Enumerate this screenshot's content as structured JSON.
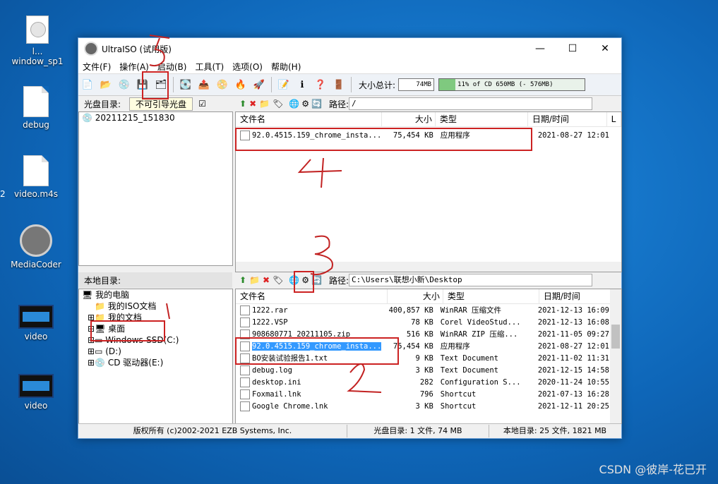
{
  "desktop": {
    "icons": [
      {
        "label": "l... window_sp1",
        "kind": "cd"
      },
      {
        "label": "debug",
        "kind": "doc"
      },
      {
        "label": "video.m4s",
        "kind": "doc"
      },
      {
        "label": "MediaCoder",
        "kind": "reel"
      },
      {
        "label": "video",
        "kind": "vid"
      },
      {
        "label": "video",
        "kind": "vid"
      }
    ],
    "edge_label": "2",
    "watermark": "CSDN @彼岸-花已开"
  },
  "window": {
    "title": "UltraISO (试用版)",
    "controls": {
      "minimize": "—",
      "maximize": "☐",
      "close": "✕"
    },
    "menu": [
      "文件(F)",
      "操作(A)",
      "启动(B)",
      "工具(T)",
      "选项(O)",
      "帮助(H)"
    ],
    "toolbar": {
      "size_label": "大小总计:",
      "size_value": "74MB",
      "capacity_text": "11% of CD 650MB (- 576MB)",
      "capacity_fraction": 0.11
    }
  },
  "iso_panel": {
    "label": "光盘目录:",
    "boot_value": "不可引导光盘",
    "tree": [
      "20211215_151830"
    ],
    "path_label": "路径:",
    "path_value": "/",
    "columns": [
      "文件名",
      "大小",
      "类型",
      "日期/时间",
      "L"
    ],
    "files": [
      {
        "name": "92.0.4515.159_chrome_insta...",
        "size": "75,454 KB",
        "type": "应用程序",
        "date": "2021-08-27 12:01"
      }
    ]
  },
  "local_panel": {
    "label": "本地目录:",
    "tree": [
      "我的电脑",
      "我的ISO文档",
      "我的文档",
      "桌面",
      "Windows-SSD(C:)",
      "(D:)",
      "CD 驱动器(E:)"
    ],
    "path_label": "路径:",
    "path_value": "C:\\Users\\联想小新\\Desktop",
    "columns": [
      "文件名",
      "大小",
      "类型",
      "日期/时间"
    ],
    "files": [
      {
        "name": "1222.rar",
        "size": "400,857 KB",
        "type": "WinRAR 压缩文件",
        "date": "2021-12-13 16:09"
      },
      {
        "name": "1222.VSP",
        "size": "78 KB",
        "type": "Corel VideoStud...",
        "date": "2021-12-13 16:08"
      },
      {
        "name": "908680771_20211105.zip",
        "size": "516 KB",
        "type": "WinRAR ZIP 压缩...",
        "date": "2021-11-05 09:27"
      },
      {
        "name": "92.0.4515.159_chrome_insta...",
        "size": "75,454 KB",
        "type": "应用程序",
        "date": "2021-08-27 12:01"
      },
      {
        "name": "BO安装试验报告1.txt",
        "size": "9 KB",
        "type": "Text Document",
        "date": "2021-11-02 11:31"
      },
      {
        "name": "debug.log",
        "size": "3 KB",
        "type": "Text Document",
        "date": "2021-12-15 14:58"
      },
      {
        "name": "desktop.ini",
        "size": "282",
        "type": "Configuration S...",
        "date": "2020-11-24 10:55"
      },
      {
        "name": "Foxmail.lnk",
        "size": "796",
        "type": "Shortcut",
        "date": "2021-07-13 16:28"
      },
      {
        "name": "Google Chrome.lnk",
        "size": "3 KB",
        "type": "Shortcut",
        "date": "2021-12-11 20:25"
      }
    ],
    "selected_index": 3
  },
  "status": {
    "copyright": "版权所有 (c)2002-2021 EZB Systems, Inc.",
    "iso_info": "光盘目录: 1 文件, 74 MB",
    "local_info": "本地目录: 25 文件, 1821 MB"
  },
  "annotations": {
    "colors": {
      "red": "#c22222"
    },
    "marks": [
      "1",
      "2",
      "3",
      "4",
      "5"
    ]
  }
}
